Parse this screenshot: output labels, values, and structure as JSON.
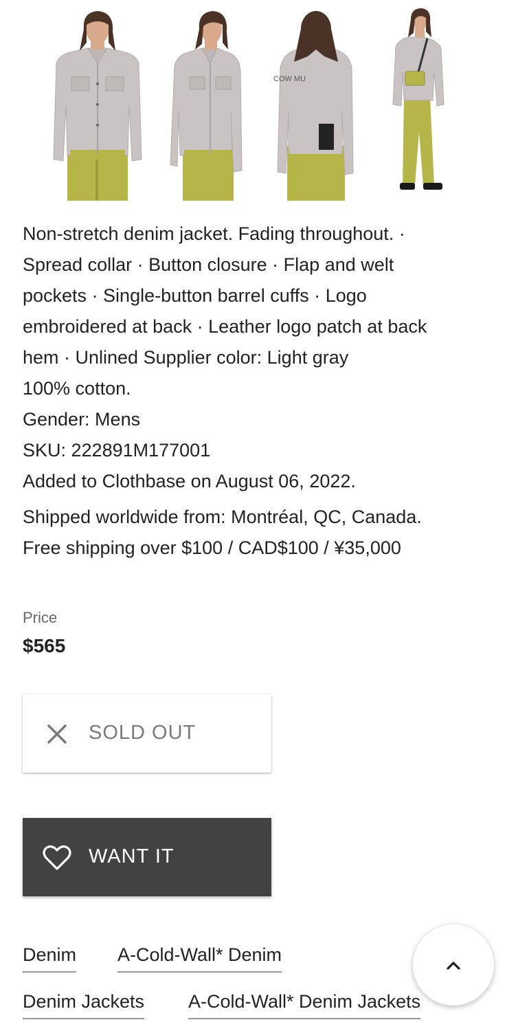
{
  "gallery": {
    "images": [
      {
        "name": "front-view"
      },
      {
        "name": "side-view"
      },
      {
        "name": "back-view"
      },
      {
        "name": "full-body-view"
      }
    ],
    "back_logo_text": "COW MU"
  },
  "description": {
    "lines": [
      "Non-stretch denim jacket. Fading throughout. ·",
      "Spread collar · Button closure · Flap and welt",
      "pockets · Single-button barrel cuffs · Logo",
      "embroidered at back · Leather logo patch at back",
      "hem · Unlined Supplier color: Light gray",
      "100% cotton.",
      "Gender: Mens",
      "SKU: 222891M177001",
      "Added to Clothbase on August 06, 2022."
    ],
    "shipping_lines": [
      "Shipped worldwide from: Montréal, QC, Canada.",
      "Free shipping over $100 / CAD$100 / ¥35,000"
    ]
  },
  "price": {
    "label": "Price",
    "value": "$565"
  },
  "buttons": {
    "sold_out": {
      "label": "SOLD OUT",
      "icon": "close-icon"
    },
    "want_it": {
      "label": "WANT IT",
      "icon": "heart-icon"
    }
  },
  "tags": [
    "Denim",
    "A-Cold-Wall* Denim",
    "Denim Jackets",
    "A-Cold-Wall* Denim Jackets"
  ],
  "scroll_top": {
    "icon": "chevron-up-icon"
  },
  "colors": {
    "jacket": "#c9c4c3",
    "pants": "#b6b54a",
    "hair": "#4a3326",
    "skin": "#d8a98b",
    "button_dark": "#424242",
    "text": "#222222",
    "muted": "#7a7a7a"
  }
}
